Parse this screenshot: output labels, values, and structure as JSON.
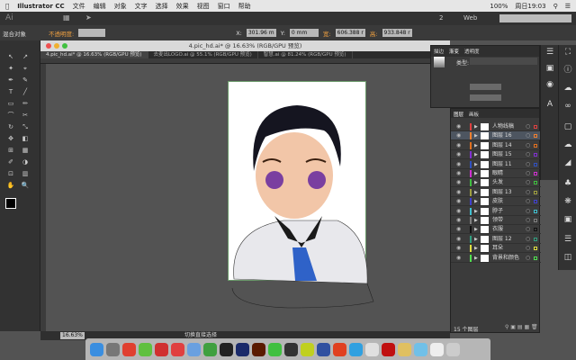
{
  "menubar": {
    "app": "Illustrator CC",
    "items": [
      "文件",
      "编辑",
      "对象",
      "文字",
      "选择",
      "效果",
      "视图",
      "窗口",
      "帮助"
    ],
    "battery": "100%",
    "clock": "周日19:03"
  },
  "appbar": {
    "logo": "Ai",
    "workspace_count": "2",
    "workspace": "Web"
  },
  "control": {
    "object_type": "混合对象",
    "opacity_label": "不透明度:",
    "x_label": "X:",
    "x": "301.96 m",
    "y_label": "Y:",
    "y": "0 mm",
    "w_label": "宽:",
    "w": "606.388 r",
    "h_label": "高:",
    "h": "933.848 r"
  },
  "document": {
    "title": "4.pic_hd.ai* @ 16.63% (RGB/GPU 预览)",
    "tabs": [
      "4.pic_hd.ai* @ 16.63% (RGB/GPU 预览)",
      "去麦出LOGO.ai @ 55.1% (RGB/GPU 预览)",
      "智慧.ai @ 81.24% (RGB/GPU 预览)"
    ]
  },
  "props": {
    "tabs": [
      "描边",
      "渐变",
      "透明度"
    ],
    "type_label": "类型:"
  },
  "layers": {
    "tabs": [
      "图层",
      "画板"
    ],
    "footer": "15 个图层",
    "items": [
      {
        "name": "人物线稿",
        "color": "#e04040"
      },
      {
        "name": "图层 16",
        "color": "#f08030",
        "selected": true
      },
      {
        "name": "图层 14",
        "color": "#e07020"
      },
      {
        "name": "图层 15",
        "color": "#8030d0"
      },
      {
        "name": "图层 11",
        "color": "#3050c0"
      },
      {
        "name": "眼睛",
        "color": "#d030d0"
      },
      {
        "name": "头发",
        "color": "#40c040"
      },
      {
        "name": "图层 13",
        "color": "#a0a040"
      },
      {
        "name": "皮肤",
        "color": "#4040d0"
      },
      {
        "name": "脖子",
        "color": "#40c0d0"
      },
      {
        "name": "领带",
        "color": "#808080"
      },
      {
        "name": "衣服",
        "color": "#111111"
      },
      {
        "name": "图层 12",
        "color": "#30a080"
      },
      {
        "name": "耳朵",
        "color": "#e0e040"
      },
      {
        "name": "背景和颜色",
        "color": "#50e050"
      }
    ]
  },
  "status": {
    "zoom": "16.63%",
    "tool_hint": "切换直接选择"
  },
  "dock": [
    "Finder",
    "Launchpad",
    "Chrome",
    "App",
    "Mail",
    "Photo",
    "Preview",
    "Evernote",
    "A",
    "Ps",
    "Ai",
    "WeChat",
    "QQ",
    "M",
    "WW",
    "NetEase",
    "Telegram",
    "Notes",
    "Flash",
    "Pages",
    "Folder",
    "Doc",
    "Trash"
  ]
}
